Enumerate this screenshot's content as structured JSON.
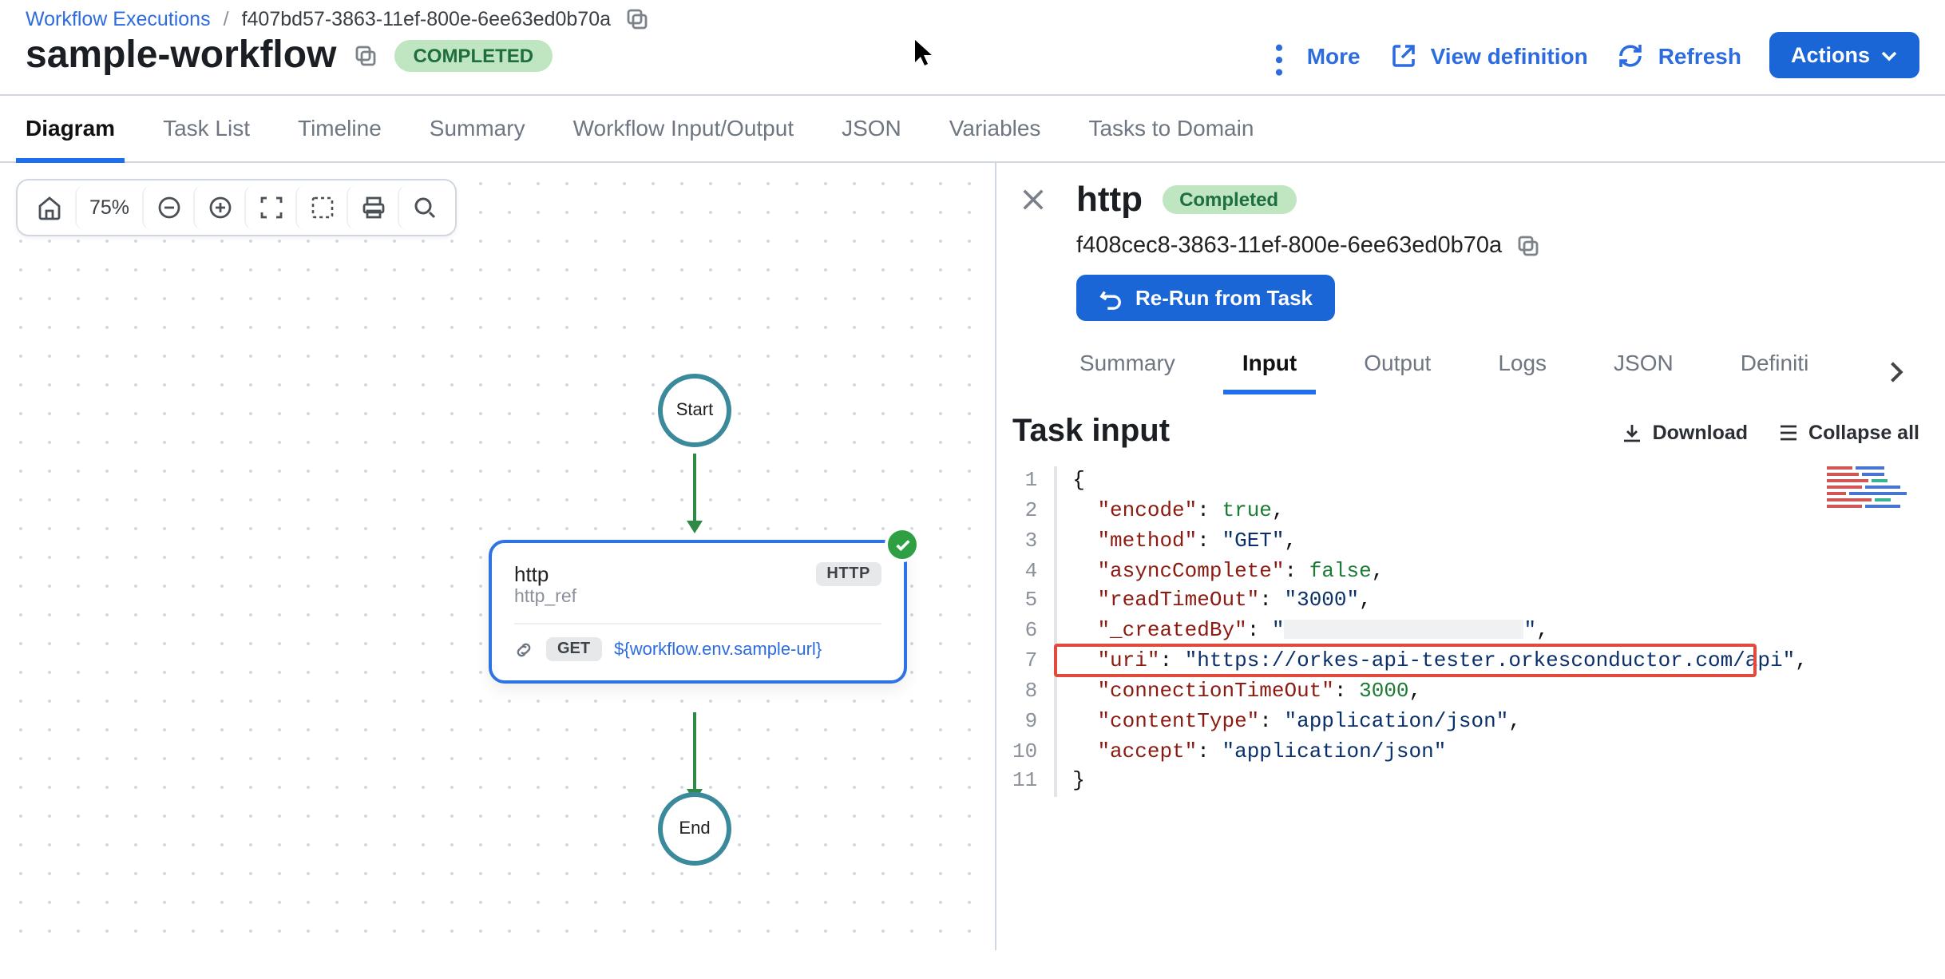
{
  "breadcrumbs": {
    "root": "Workflow Executions",
    "sep": "/",
    "id": "f407bd57-3863-11ef-800e-6ee63ed0b70a"
  },
  "workflow": {
    "name": "sample-workflow",
    "status": "COMPLETED"
  },
  "top_actions": {
    "more": "More",
    "view_def": "View definition",
    "refresh": "Refresh",
    "actions": "Actions"
  },
  "main_tabs": [
    "Diagram",
    "Task List",
    "Timeline",
    "Summary",
    "Workflow Input/Output",
    "JSON",
    "Variables",
    "Tasks to Domain"
  ],
  "active_main_tab": "Diagram",
  "canvas": {
    "zoom": "75%",
    "start": "Start",
    "end": "End"
  },
  "node": {
    "title": "http",
    "ref": "http_ref",
    "badge": "HTTP",
    "method": "GET",
    "url": "${workflow.env.sample-url}"
  },
  "panel": {
    "title": "http",
    "status": "Completed",
    "task_id": "f408cec8-3863-11ef-800e-6ee63ed0b70a",
    "rerun": "Re-Run from Task",
    "tabs": [
      "Summary",
      "Input",
      "Output",
      "Logs",
      "JSON",
      "Definition"
    ],
    "active_tab": "Input",
    "section_title": "Task input",
    "download": "Download",
    "collapse": "Collapse all"
  },
  "task_input_json": {
    "encode": true,
    "method": "GET",
    "asyncComplete": false,
    "readTimeOut": "3000",
    "_createdBy": "",
    "uri": "https://orkes-api-tester.orkesconductor.com/api",
    "connectionTimeOut": 3000,
    "contentType": "application/json",
    "accept": "application/json"
  },
  "colors": {
    "accent": "#1f6feb",
    "green_bg": "#bfe6c1",
    "highlight_border": "#e24a3b"
  }
}
